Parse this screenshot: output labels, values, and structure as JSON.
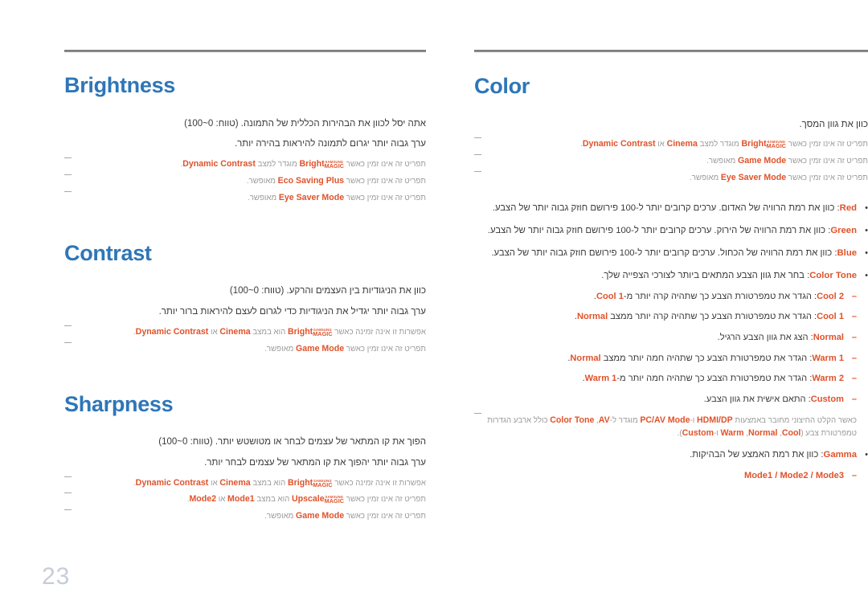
{
  "page": {
    "number": "23",
    "accent_blue": "#2e76b8",
    "accent_orange": "#e0522a",
    "note_gray": "#9a9a9a",
    "body_gray": "#3a3a3a",
    "rule_gray": "#8c8c8c"
  },
  "magic_logo": {
    "top": "SAMSUNG",
    "bottom": "MAGIC"
  },
  "markers": {
    "bullet": "•",
    "dash": "–",
    "slash": "/"
  },
  "left_column": {
    "title": "Color",
    "intro": "כוון את גוון המסך.",
    "notes": [
      {
        "pre": "תפריט זה אינו זמין כאשר",
        "logo": true,
        "kw1": "Bright",
        "mid": "מוגדר למצב",
        "kw2": "Cinema",
        "conj": "או",
        "kw3": "Dynamic Contrast",
        "post": "."
      },
      {
        "pre": "תפריט זה אינו זמין כאשר",
        "logo": false,
        "kw1": "Game Mode",
        "mid": "מאופשר.",
        "kw2": "",
        "conj": "",
        "kw3": "",
        "post": ""
      },
      {
        "pre": "תפריט זה אינו זמין כאשר",
        "logo": false,
        "kw1": "Eye Saver Mode",
        "mid": "מאופשר.",
        "kw2": "",
        "conj": "",
        "kw3": "",
        "post": ""
      }
    ],
    "bullets": [
      {
        "kw": "Red",
        "text": ": כוון את רמת הרוויה של האדום. ערכים קרובים יותר ל-100 פירושם חוזק גבוה יותר של הצבע."
      },
      {
        "kw": "Green",
        "text": ": כוון את רמת הרוויה של הירוק. ערכים קרובים יותר ל-100 פירושם חוזק גבוה יותר של הצבע."
      },
      {
        "kw": "Blue",
        "text": ": כוון את רמת הרוויה של הכחול. ערכים קרובים יותר ל-100 פירושם חוזק גבוה יותר של הצבע."
      }
    ],
    "color_tone": {
      "kw": "Color Tone",
      "text": ": בחר את גוון הצבע המתאים ביותר לצורכי הצפייה שלך.",
      "sub": [
        {
          "kw": "Cool 2",
          "text": ": הגדר את טמפרטורת הצבע כך שתהיה קרה יותר מ-",
          "kw_end": "Cool 1",
          "tail": "."
        },
        {
          "kw": "Cool 1",
          "text": ": הגדר את טמפרטורת הצבע כך שתהיה קרה יותר ממצב ",
          "kw_end": "Normal",
          "tail": "."
        },
        {
          "kw": "Normal",
          "text": ": הצג את גוון הצבע הרגיל.",
          "kw_end": "",
          "tail": ""
        },
        {
          "kw": "Warm 1",
          "text": ": הגדר את טמפרטורת הצבע כך שתהיה חמה יותר ממצב ",
          "kw_end": "Normal",
          "tail": "."
        },
        {
          "kw": "Warm 2",
          "text": ": הגדר את טמפרטורת הצבע כך שתהיה חמה יותר מ-",
          "kw_end": "Warm 1",
          "tail": "."
        },
        {
          "kw": "Custom",
          "text": ": התאם אישית את גוון הצבע.",
          "kw_end": "",
          "tail": ""
        }
      ],
      "note": {
        "p1": "כאשר הקלט החיצוני מחובר באמצעות",
        "kw1": "HDMI/DP",
        "p2": "ו-",
        "kw2": "PC/AV Mode",
        "p3": "מוגדר ל-",
        "kw3": "AV",
        "p4": ",",
        "kw4": "Color Tone",
        "p5": "כולל ארבע הגדרות טמפרטורת צבע (",
        "kw5": "Cool",
        "p6": ",",
        "kw6": "Normal",
        "p7": ",",
        "kw7": "Warm",
        "p8": "ו-",
        "kw8": "Custom",
        "p9": ")."
      }
    },
    "gamma": {
      "kw": "Gamma",
      "text": ": כוון את רמת האמצע של הבהיקות.",
      "modes": [
        "Mode1",
        "Mode2",
        "Mode3"
      ]
    }
  },
  "right_column": {
    "sections": [
      {
        "title": "Brightness",
        "lines": [
          "אתה יסל לכוון את הבהירות הכללית של התמונה. (טווח: 0~100)",
          "ערך גבוה יותר יגרום לתמונה להיראות בהירה יותר."
        ],
        "notes": [
          {
            "pre": "תפריט זה אינו זמין כאשר",
            "logo": true,
            "kw1": "Bright",
            "mid": "מוגדר למצב",
            "kw2": "Dynamic Contrast",
            "post": "."
          },
          {
            "pre": "תפריט זה אינו זמין כאשר",
            "logo": false,
            "kw1": "Eco Saving Plus",
            "mid": "מאופשר.",
            "kw2": "",
            "post": ""
          },
          {
            "pre": "תפריט זה אינו זמין כאשר",
            "logo": false,
            "kw1": "Eye Saver Mode",
            "mid": "מאופשר.",
            "kw2": "",
            "post": ""
          }
        ]
      },
      {
        "title": "Contrast",
        "lines": [
          "כוון את הניגודיות בין העצמים והרקע. (טווח: 0~100)",
          "ערך גבוה יותר יגדיל את הניגודיות כדי לגרום לעצם להיראות ברור יותר."
        ],
        "notes": [
          {
            "pre": "אפשרות זו אינה זמינה כאשר",
            "logo": true,
            "kw1": "Bright",
            "mid": "הוא במצב",
            "kw2": "Cinema",
            "conj": "או",
            "kw3": "Dynamic Contrast",
            "post": "."
          },
          {
            "pre": "תפריט זה אינו זמין כאשר",
            "logo": false,
            "kw1": "Game Mode",
            "mid": "מאופשר.",
            "kw2": "",
            "post": ""
          }
        ]
      },
      {
        "title": "Sharpness",
        "lines": [
          "הפוך את קו המתאר של עצמים לבחר או מטושטש יותר. (טווח: 0~100)",
          "ערך גבוה יותר יהפוך את קו המתאר של עצמים לבחר יותר."
        ],
        "notes": [
          {
            "pre": "אפשרות זו אינה זמינה כאשר",
            "logo": true,
            "kw1": "Bright",
            "mid": "הוא במצב",
            "kw2": "Cinema",
            "conj": "או",
            "kw3": "Dynamic Contrast",
            "post": "."
          },
          {
            "pre": "תפריט זה אינו זמין כאשר",
            "logo": true,
            "kw1": "Upscale",
            "mid": "הוא במצב",
            "kw2": "Mode1",
            "conj": "או",
            "kw3": "Mode2",
            "post": "."
          },
          {
            "pre": "תפריט זה אינו זמין כאשר",
            "logo": false,
            "kw1": "Game Mode",
            "mid": "מאופשר.",
            "kw2": "",
            "post": ""
          }
        ]
      }
    ]
  }
}
